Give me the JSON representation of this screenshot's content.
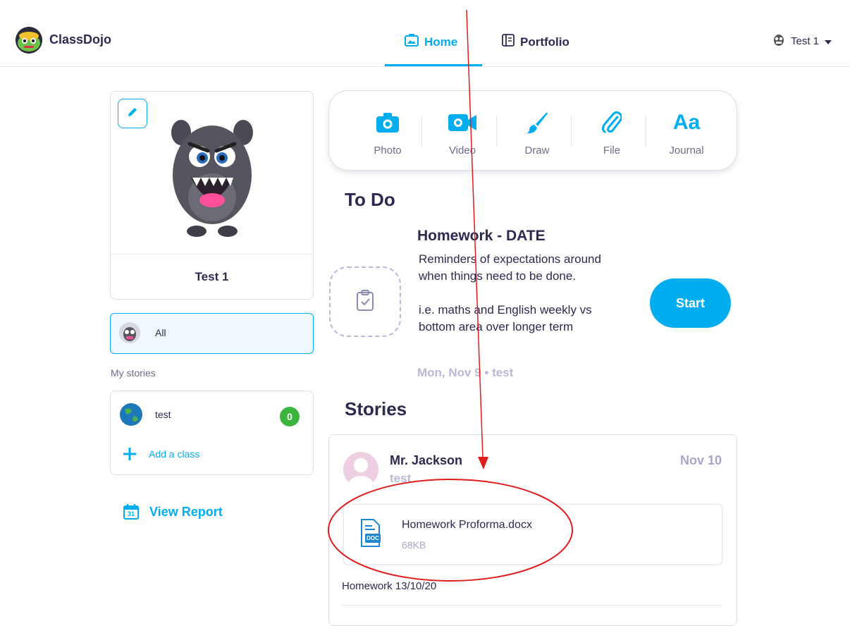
{
  "header": {
    "brand": "ClassDojo",
    "tabs": [
      {
        "label": "Home",
        "active": true
      },
      {
        "label": "Portfolio",
        "active": false
      }
    ],
    "user": {
      "name": "Test 1"
    }
  },
  "profile": {
    "name": "Test 1"
  },
  "filters": {
    "all_label": "All",
    "my_stories_label": "My stories",
    "classes": [
      {
        "name": "test",
        "count": "0"
      }
    ],
    "add_class_label": "Add a class",
    "view_report_label": "View Report",
    "calendar_day": "31"
  },
  "composer": {
    "tools": [
      {
        "label": "Photo",
        "icon": "camera-icon"
      },
      {
        "label": "Video",
        "icon": "video-camera-icon"
      },
      {
        "label": "Draw",
        "icon": "paintbrush-icon"
      },
      {
        "label": "File",
        "icon": "paperclip-icon"
      },
      {
        "label": "Journal",
        "icon": "text-icon",
        "glyph": "Aa"
      }
    ]
  },
  "todo": {
    "heading": "To Do",
    "title": "Homework - DATE",
    "desc_line1": " Reminders of expectations around when things need to be done.",
    "desc_line2": " i.e. maths and English weekly vs bottom area over longer term",
    "meta": "Mon, Nov 9  •  test",
    "start_label": "Start"
  },
  "stories": {
    "heading": "Stories",
    "items": [
      {
        "author": "Mr. Jackson",
        "class": "test",
        "date": "Nov 10",
        "file": {
          "name": "Homework Proforma.docx",
          "size": "68KB",
          "type_label": "DOC"
        },
        "text": "Homework 13/10/20"
      }
    ]
  },
  "colors": {
    "accent": "#00aeef",
    "text": "#2c2a50",
    "muted": "#b9b8d8",
    "badge": "#3db53d",
    "annotation": "#e01b1b"
  }
}
